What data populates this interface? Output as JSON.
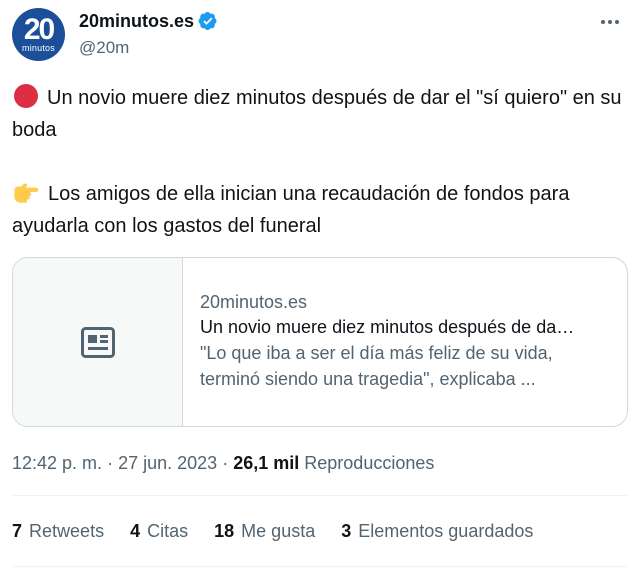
{
  "account": {
    "avatar_number": "20",
    "avatar_word": "minutos",
    "display_name": "20minutos.es",
    "handle": "@20m",
    "verified_icon": "verified-badge-icon",
    "accent_color": "#1d9bf0"
  },
  "tweet": {
    "paragraphs": [
      {
        "emoji": "red-circle-emoji",
        "text": "Un novio muere diez minutos después de dar el \"sí quiero\" en su boda"
      },
      {
        "emoji": "pointing-right-hand-emoji",
        "text": "Los amigos de ella inician una recaudación de fondos para ayudarla con los gastos del funeral"
      }
    ]
  },
  "card": {
    "icon": "newspaper-icon",
    "domain": "20minutos.es",
    "title": "Un novio muere diez minutos después de da…",
    "description": "\"Lo que iba a ser el día más feliz de su vida, terminó siendo una tragedia\", explicaba ..."
  },
  "meta": {
    "time": "12:42 p. m.",
    "separator": "·",
    "date": "27 jun. 2023",
    "views_count": "26,1 mil",
    "views_label": "Reproducciones"
  },
  "stats": [
    {
      "count": "7",
      "label": "Retweets"
    },
    {
      "count": "4",
      "label": "Citas"
    },
    {
      "count": "18",
      "label": "Me gusta"
    },
    {
      "count": "3",
      "label": "Elementos guardados"
    }
  ]
}
